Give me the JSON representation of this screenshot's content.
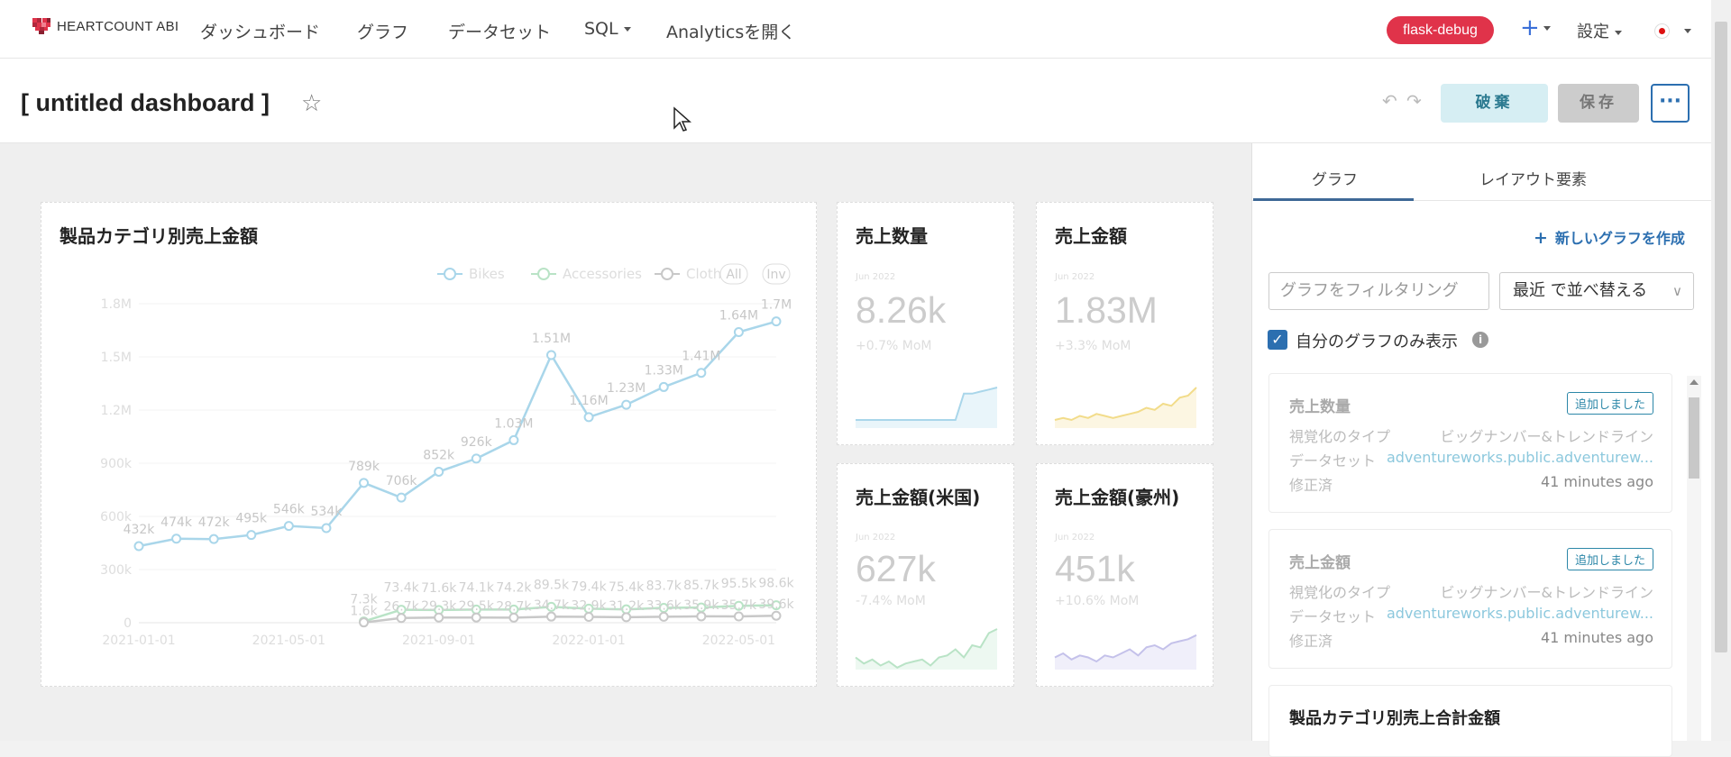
{
  "nav": {
    "brand": "HEARTCOUNT ABI",
    "links": [
      "ダッシュボード",
      "グラフ",
      "データセット",
      "SQL",
      "Analyticsを開く"
    ],
    "env_badge": "flask-debug",
    "plus": "+",
    "settings": "設定"
  },
  "header": {
    "title": "[ untitled dashboard ]",
    "discard": "破棄",
    "save": "保存",
    "more": "···"
  },
  "main_chart": {
    "title": "製品カテゴリ別売上金額",
    "legend": [
      "Bikes",
      "Accessories",
      "Clothing"
    ],
    "legend_all": "All",
    "legend_inv": "Inv",
    "colors": {
      "bikes": "#a9d6ea",
      "accessories": "#b9e3c6",
      "clothing": "#c8c8c8"
    }
  },
  "chart_data": {
    "type": "line",
    "title": "製品カテゴリ別売上金額",
    "x_tick_labels": [
      "2021-01-01",
      "2021-05-01",
      "2021-09-01",
      "2022-01-01",
      "2022-05-01"
    ],
    "y_tick_labels": [
      "0",
      "300k",
      "600k",
      "900k",
      "1.2M",
      "1.5M",
      "1.8M"
    ],
    "ylim": [
      0,
      1800000
    ],
    "x": [
      "2021-01",
      "2021-02",
      "2021-03",
      "2021-04",
      "2021-05",
      "2021-06",
      "2021-07",
      "2021-08",
      "2021-09",
      "2021-10",
      "2021-11",
      "2021-12",
      "2022-01",
      "2022-02",
      "2022-03",
      "2022-04",
      "2022-05",
      "2022-06"
    ],
    "series": [
      {
        "name": "Bikes",
        "values": [
          432000,
          474000,
          472000,
          495000,
          546000,
          534000,
          789000,
          706000,
          852000,
          926000,
          1030000,
          1510000,
          1160000,
          1230000,
          1330000,
          1410000,
          1640000,
          1700000
        ],
        "labels": [
          "432k",
          "474k",
          "472k",
          "495k",
          "546k",
          "534k",
          "789k",
          "706k",
          "852k",
          "926k",
          "1.03M",
          "1.51M",
          "1.16M",
          "1.23M",
          "1.33M",
          "1.41M",
          "1.64M",
          "1.7M"
        ]
      },
      {
        "name": "Accessories",
        "values": [
          null,
          null,
          null,
          null,
          null,
          null,
          7300,
          73400,
          71600,
          74100,
          74200,
          89500,
          79400,
          75400,
          83700,
          85700,
          95500,
          98600
        ],
        "labels": [
          "7.3k",
          "73.4k",
          "71.6k",
          "74.1k",
          "74.2k",
          "89.5k",
          "79.4k",
          "75.4k",
          "83.7k",
          "85.7k",
          "95.5k",
          "98.6k"
        ]
      },
      {
        "name": "Clothing",
        "values": [
          null,
          null,
          null,
          null,
          null,
          null,
          1600,
          26700,
          29300,
          29500,
          28700,
          34700,
          32900,
          31200,
          33600,
          35900,
          35700,
          39600
        ],
        "labels": [
          "1.6k",
          "26.7k",
          "29.3k",
          "29.5k",
          "28.7k",
          "34.7k",
          "32.9k",
          "31.2k",
          "33.6k",
          "35.9k",
          "35.7k",
          "39.6k"
        ]
      }
    ]
  },
  "big_numbers": [
    {
      "title": "売上数量",
      "date": "Jun 2022",
      "value": "8.26k",
      "delta": "+0.7% MoM",
      "color": "#a9d6ea"
    },
    {
      "title": "売上金額",
      "date": "Jun 2022",
      "value": "1.83M",
      "delta": "+3.3% MoM",
      "color": "#f2dc8a"
    },
    {
      "title": "売上金額(米国)",
      "date": "Jun 2022",
      "value": "627k",
      "delta": "-7.4% MoM",
      "color": "#b9e3c6"
    },
    {
      "title": "売上金額(豪州)",
      "date": "Jun 2022",
      "value": "451k",
      "delta": "+10.6% MoM",
      "color": "#c4c1ea"
    }
  ],
  "panel": {
    "tabs": [
      "グラフ",
      "レイアウト要素"
    ],
    "new_chart": "新しいグラフを作成",
    "filter_placeholder": "グラフをフィルタリング",
    "sort_label": "最近 で並べ替える",
    "only_mine_label": "自分のグラフのみ表示",
    "field_labels": {
      "viz_type": "視覚化のタイプ",
      "dataset": "データセット",
      "modified": "修正済"
    },
    "cards": [
      {
        "title": "売上数量",
        "badge": "追加しました",
        "viz_type": "ビッグナンバー&トレンドライン",
        "dataset": "adventureworks.public.adventurew...",
        "modified": "41 minutes ago"
      },
      {
        "title": "売上金額",
        "badge": "追加しました",
        "viz_type": "ビッグナンバー&トレンドライン",
        "dataset": "adventureworks.public.adventurew...",
        "modified": "41 minutes ago"
      },
      {
        "title": "製品カテゴリ別売上合計金額"
      }
    ]
  }
}
